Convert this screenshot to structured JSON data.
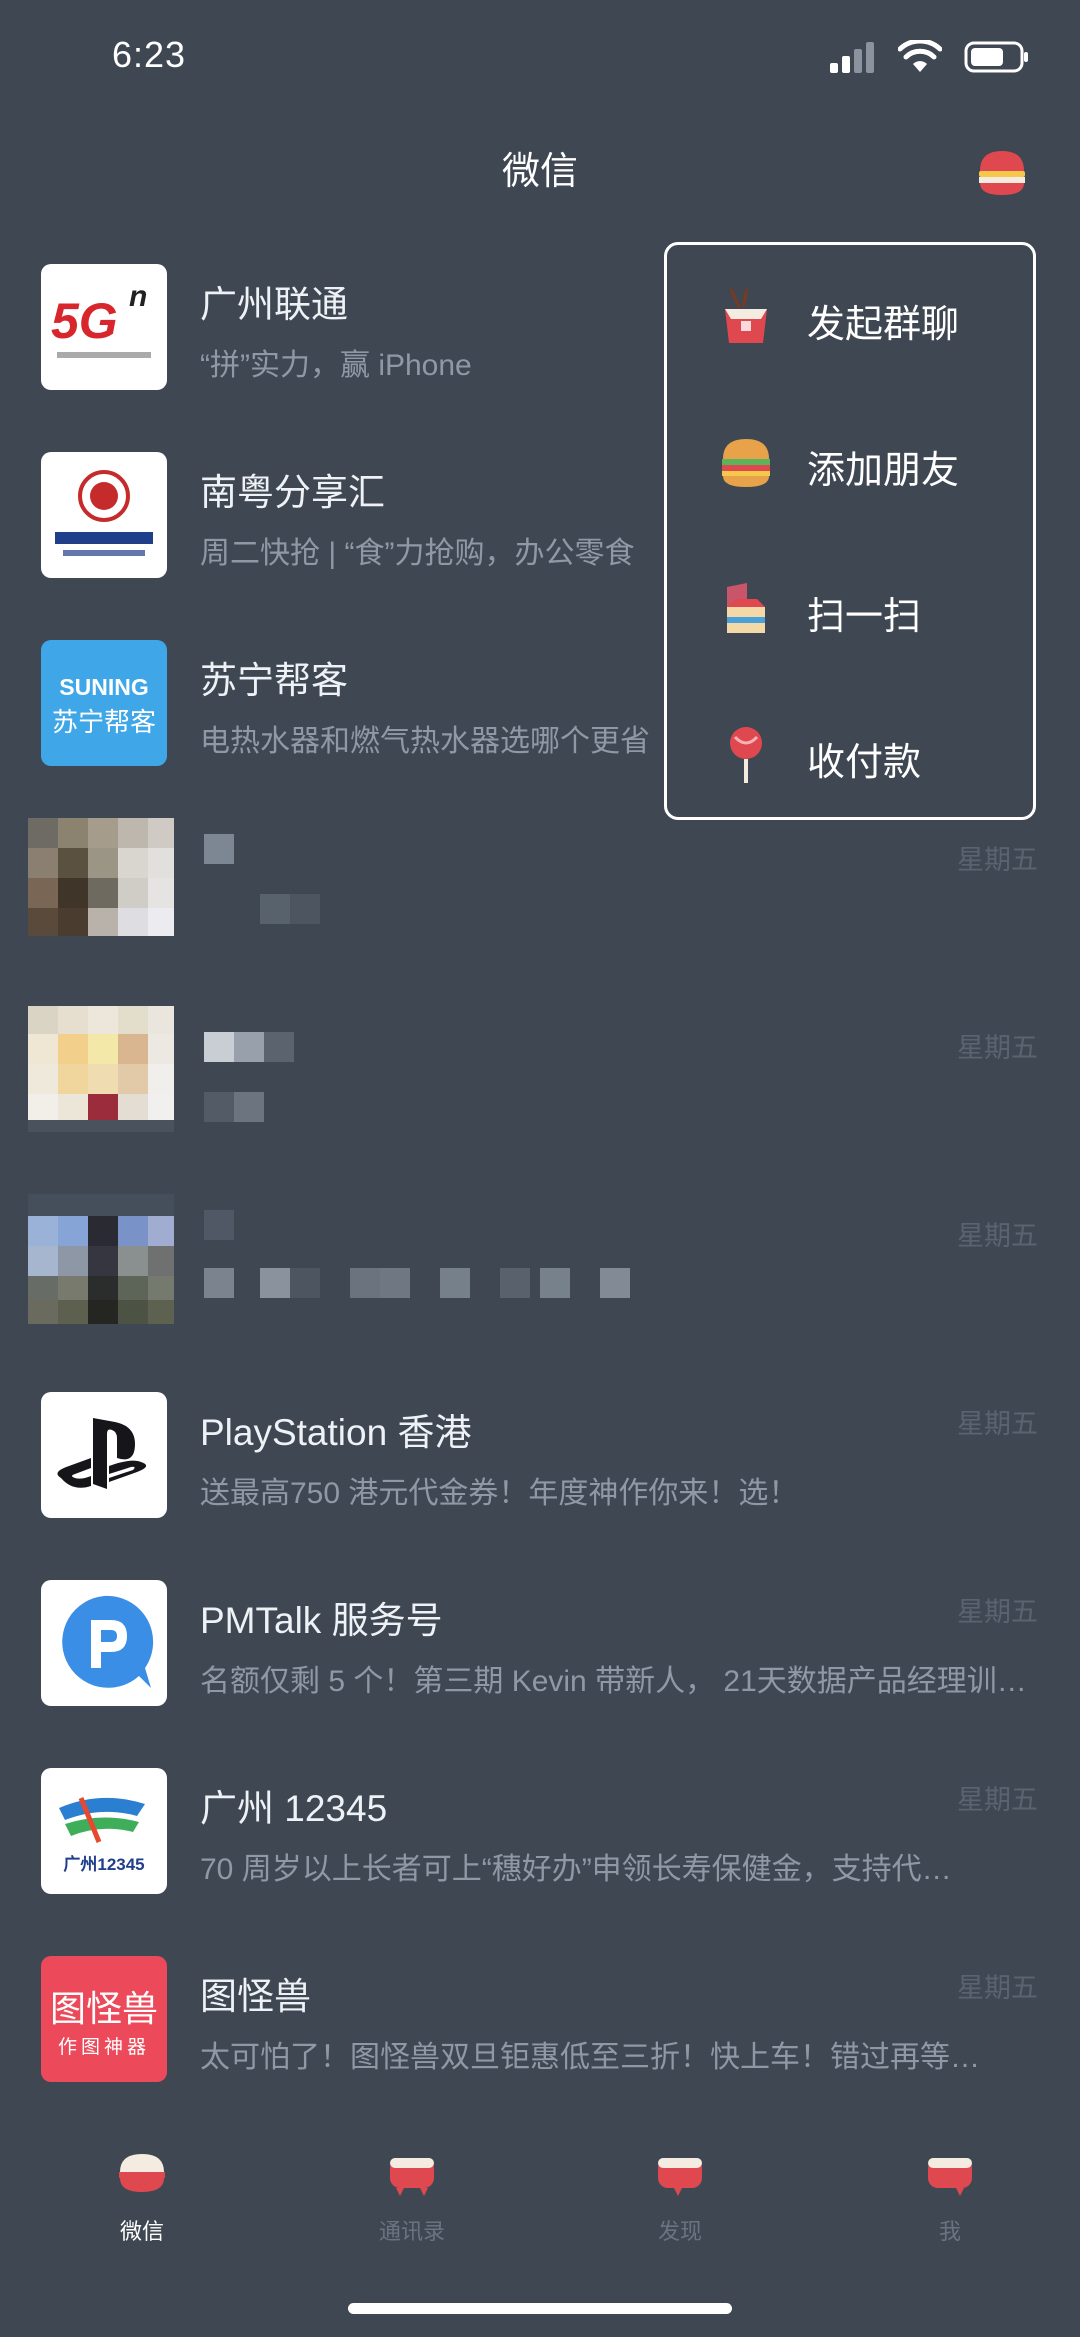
{
  "status_bar": {
    "time": "6:23"
  },
  "header": {
    "title": "微信"
  },
  "chats": [
    {
      "name": "广州联通",
      "preview": "“拼”实力，赢 iPhone",
      "time": "",
      "avatar": "5G-logo"
    },
    {
      "name": "南粤分享汇",
      "preview": "周二快抢 | “食”力抢购，办公零食",
      "time": "",
      "avatar": "nanyue-logo"
    },
    {
      "name": "苏宁帮客",
      "preview": "电热水器和燃气热水器选哪个更省",
      "time": "",
      "avatar": "suning-logo",
      "avatar_top": "SUNING",
      "avatar_bottom": "苏宁帮客"
    },
    {
      "name": "",
      "preview": "",
      "time": "星期五",
      "avatar": "pixelated-avatar"
    },
    {
      "name": "",
      "preview": "",
      "time": "星期五",
      "avatar": "pixelated-avatar"
    },
    {
      "name": "",
      "preview": "",
      "time": "星期五",
      "avatar": "pixelated-avatar"
    },
    {
      "name": "PlayStation 香港",
      "preview": "送最高750 港元代金券！年度神作你来！选！",
      "time": "星期五",
      "avatar": "playstation-logo"
    },
    {
      "name": "PMTalk 服务号",
      "preview": "名额仅剩 5 个！第三期 Kevin 带新人， 21天数据产品经理训…",
      "time": "星期五",
      "avatar": "pmtalk-logo"
    },
    {
      "name": "广州 12345",
      "preview": "70 周岁以上长者可上“穗好办”申领长寿保健金，支持代…",
      "time": "星期五",
      "avatar": "gz12345-logo",
      "avatar_text": "广州12345"
    },
    {
      "name": "图怪兽",
      "preview": "太可怕了！图怪兽双旦钜惠低至三折！快上车！错过再等…",
      "time": "星期五",
      "avatar": "tuguaishou-logo",
      "avatar_top": "图怪兽",
      "avatar_bottom": "作图神器"
    }
  ],
  "popup_menu": {
    "items": [
      {
        "label": "发起群聊",
        "icon": "takeout-box-icon"
      },
      {
        "label": "添加朋友",
        "icon": "burger-icon"
      },
      {
        "label": "扫一扫",
        "icon": "cake-slice-icon"
      },
      {
        "label": "收付款",
        "icon": "lollipop-icon"
      }
    ]
  },
  "tab_bar": {
    "tabs": [
      {
        "label": "微信",
        "active": true
      },
      {
        "label": "通讯录",
        "active": false
      },
      {
        "label": "发现",
        "active": false
      },
      {
        "label": "我",
        "active": false
      }
    ]
  },
  "colors": {
    "background": "#3f4752",
    "text": "#eef1f5",
    "secondary_text": "#8f99a6",
    "muted": "#5a6470",
    "accent_red": "#e0484f",
    "ps_black": "#16161a",
    "suning_blue": "#3fa7e8",
    "tuguaishou_red": "#ec4a5a"
  }
}
